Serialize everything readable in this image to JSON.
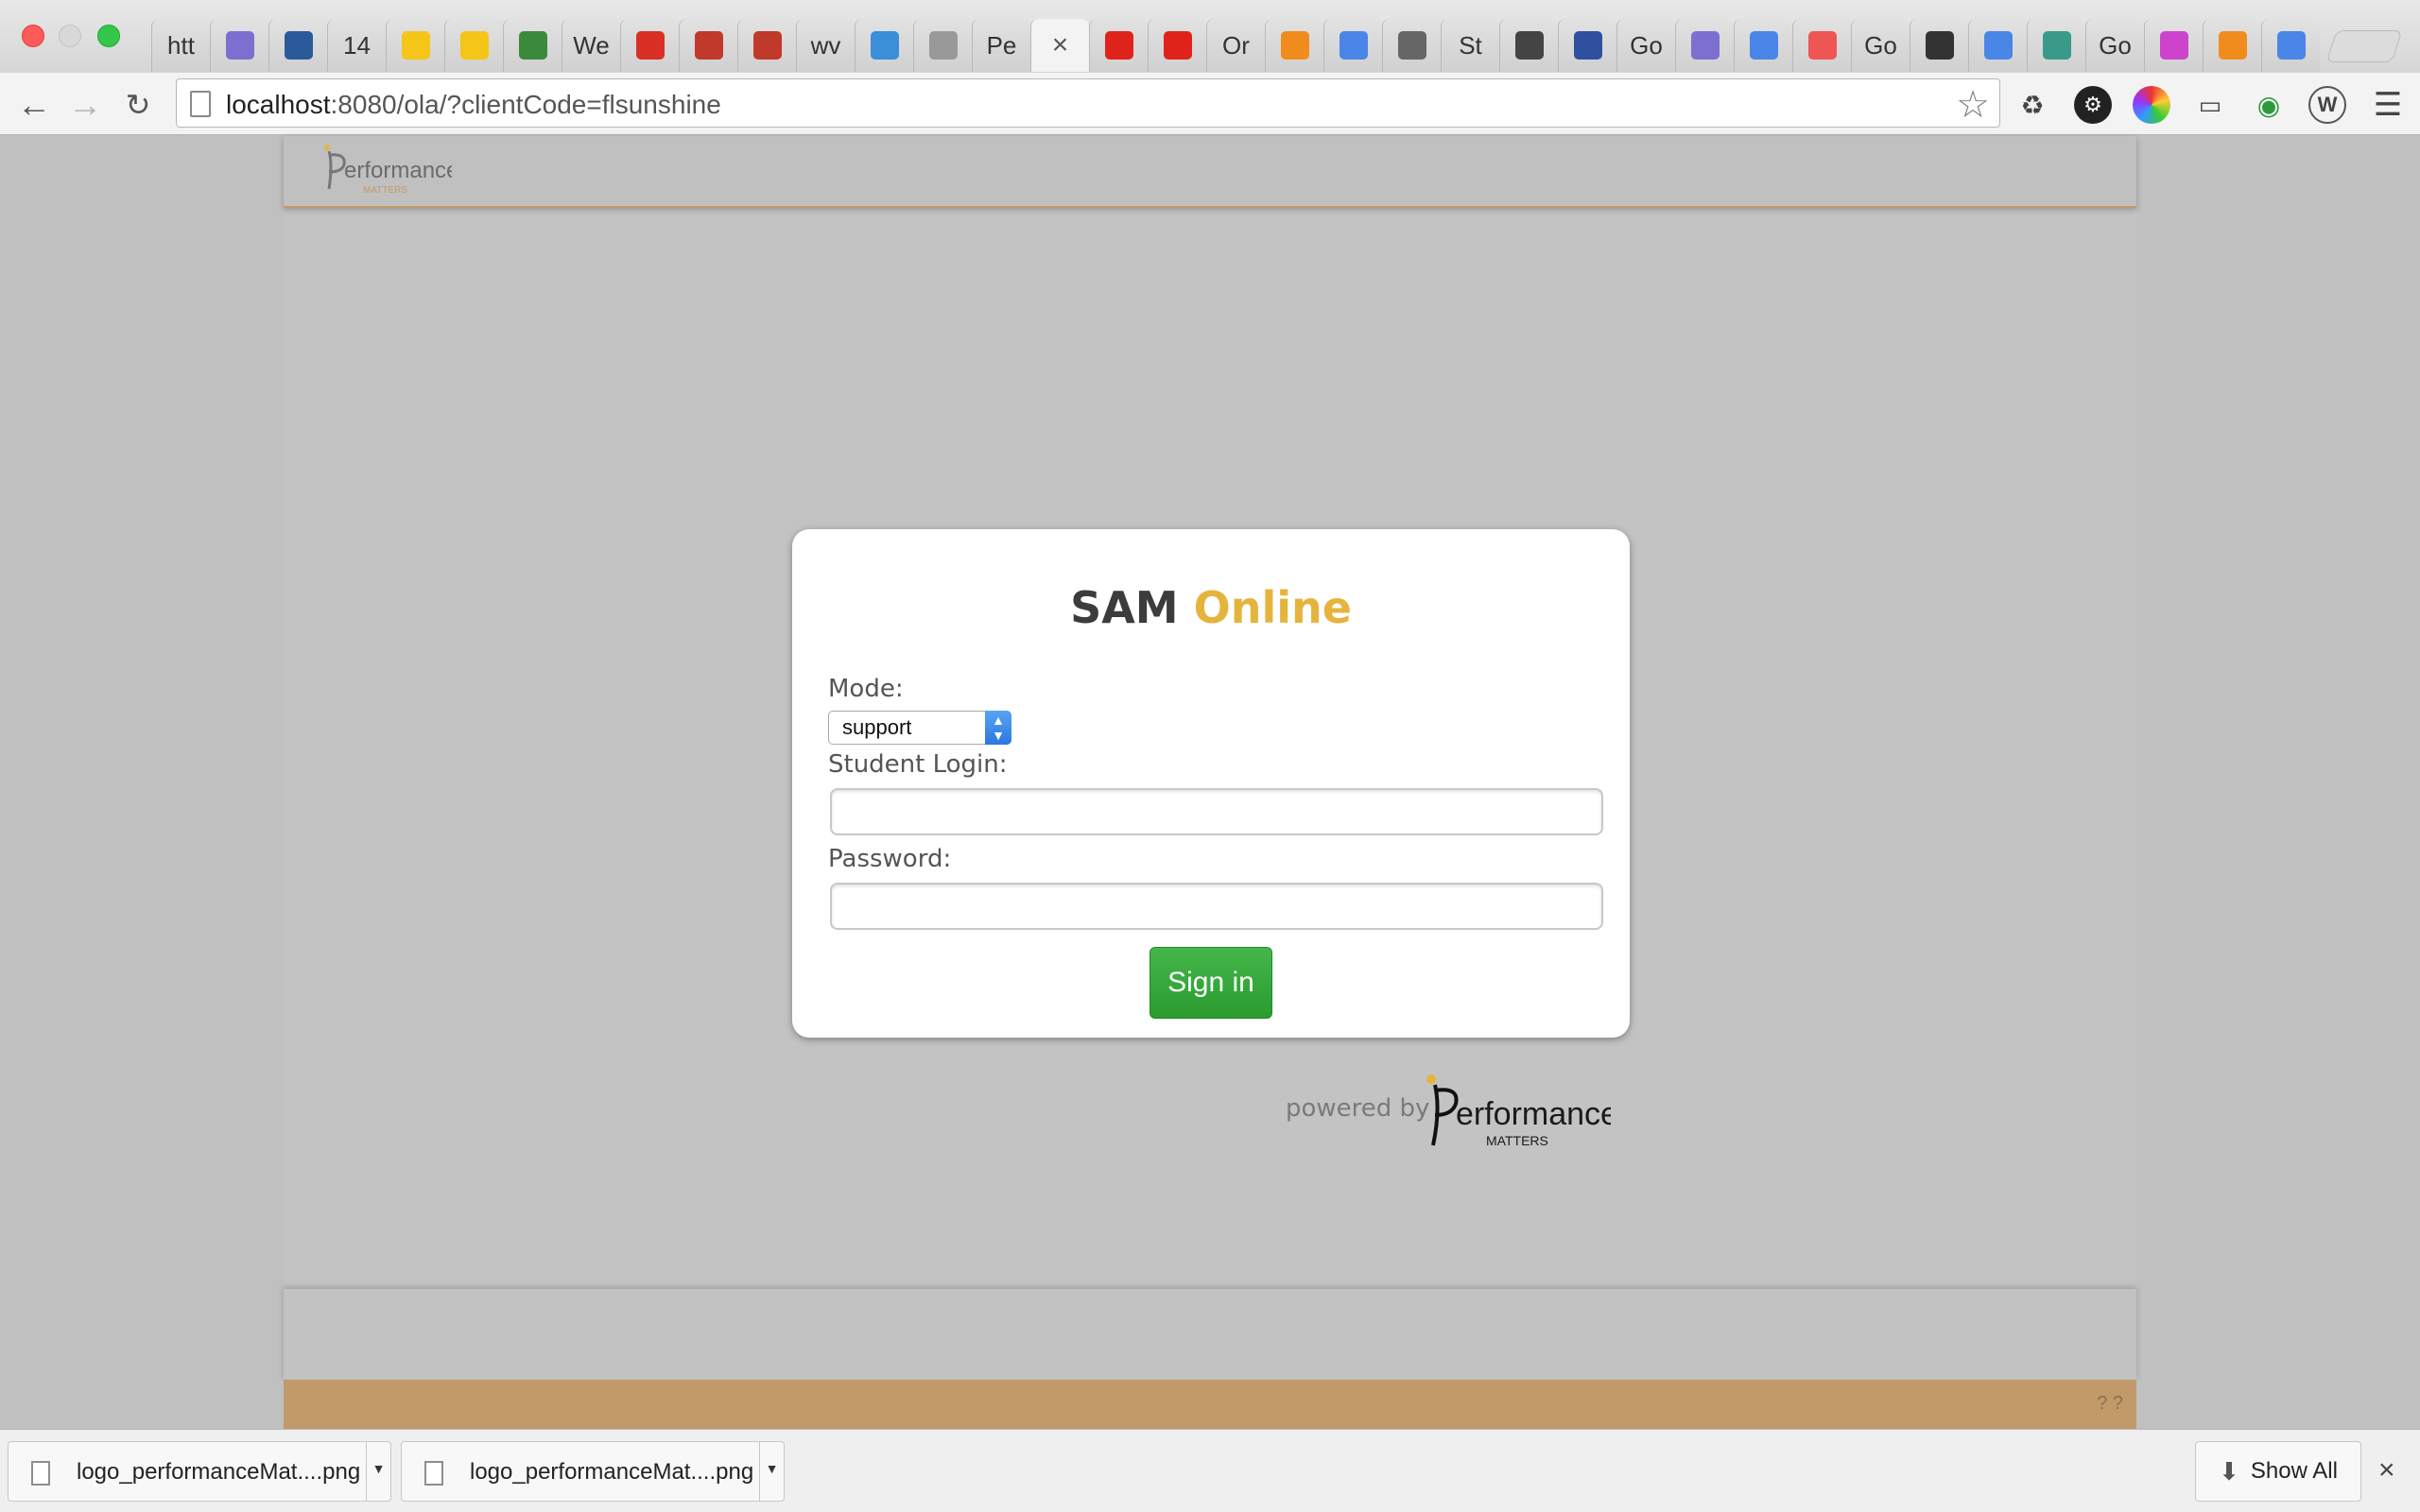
{
  "browser": {
    "tabs": [
      {
        "label": "htt",
        "icon": "text"
      },
      {
        "label": "",
        "icon": "circles-icon",
        "color": "#7b6fd0"
      },
      {
        "label": "",
        "icon": "person-icon",
        "color": "#2b5a9a"
      },
      {
        "label": "14",
        "icon": "text"
      },
      {
        "label": "",
        "icon": "star-icon",
        "color": "#f5c518"
      },
      {
        "label": "",
        "icon": "star-icon",
        "color": "#f5c518"
      },
      {
        "label": "",
        "icon": "w-circle-icon",
        "color": "#3b8a3b"
      },
      {
        "label": "We",
        "icon": "text"
      },
      {
        "label": "",
        "icon": "gmail-icon",
        "color": "#d93025"
      },
      {
        "label": "",
        "icon": "edx-icon",
        "color": "#c0392b"
      },
      {
        "label": "",
        "icon": "edx-icon",
        "color": "#c0392b"
      },
      {
        "label": "wv",
        "icon": "text"
      },
      {
        "label": "",
        "icon": "s-icon",
        "color": "#3a8fd8"
      },
      {
        "label": "",
        "icon": "page-icon",
        "color": "#999999"
      },
      {
        "label": "Pe",
        "icon": "text"
      },
      {
        "label": "×",
        "icon": "close-icon",
        "active": true
      },
      {
        "label": "",
        "icon": "adobe-icon",
        "color": "#e0231a"
      },
      {
        "label": "",
        "icon": "youtube-icon",
        "color": "#e0231a"
      },
      {
        "label": "Or",
        "icon": "text"
      },
      {
        "label": "",
        "icon": "asterisk-icon",
        "color": "#f08c1e"
      },
      {
        "label": "",
        "icon": "g-icon",
        "color": "#4a86e8"
      },
      {
        "label": "",
        "icon": "portrait-icon",
        "color": "#666666"
      },
      {
        "label": "St",
        "icon": "text"
      },
      {
        "label": "",
        "icon": "cloud-icon",
        "color": "#444444"
      },
      {
        "label": "",
        "icon": "grid-icon",
        "color": "#2f4f9f"
      },
      {
        "label": "Go",
        "icon": "text"
      },
      {
        "label": "",
        "icon": "circles-icon",
        "color": "#7b6fd0"
      },
      {
        "label": "",
        "icon": "g-icon",
        "color": "#4a86e8"
      },
      {
        "label": "",
        "icon": "book-icon",
        "color": "#e55"
      },
      {
        "label": "Go",
        "icon": "text"
      },
      {
        "label": "",
        "icon": "slash-icon",
        "color": "#333333"
      },
      {
        "label": "",
        "icon": "g-icon",
        "color": "#4a86e8"
      },
      {
        "label": "",
        "icon": "h-icon",
        "color": "#3a9a8a"
      },
      {
        "label": "Go",
        "icon": "text"
      },
      {
        "label": "",
        "icon": "color-wheel-icon",
        "color": "#cc44cc"
      },
      {
        "label": "",
        "icon": "asterisk-icon",
        "color": "#f08c1e"
      },
      {
        "label": "",
        "icon": "g-icon",
        "color": "#4a86e8"
      }
    ],
    "url_host": "localhost",
    "url_rest": ":8080/ola/?clientCode=flsunshine"
  },
  "header": {
    "logo_text": "erformance",
    "logo_subtext": "MATTERS"
  },
  "login": {
    "title_part1": "SAM",
    "title_part2": "Online",
    "mode_label": "Mode:",
    "mode_value": "support",
    "student_login_label": "Student Login:",
    "student_login_value": "",
    "password_label": "Password:",
    "password_value": "",
    "signin_label": "Sign in"
  },
  "powered_by": {
    "text": "powered by",
    "logo_text": "erformance",
    "logo_subtext": "MATTERS"
  },
  "footer": {
    "corner_text": "? ?"
  },
  "downloads": {
    "items": [
      {
        "name": "logo_performanceMat....png"
      },
      {
        "name": "logo_performanceMat....png"
      }
    ],
    "show_all_label": "Show All"
  },
  "colors": {
    "brand_gold": "#e5b43d",
    "footer_tan": "#c29a6a",
    "signin_green": "#2fa534"
  }
}
